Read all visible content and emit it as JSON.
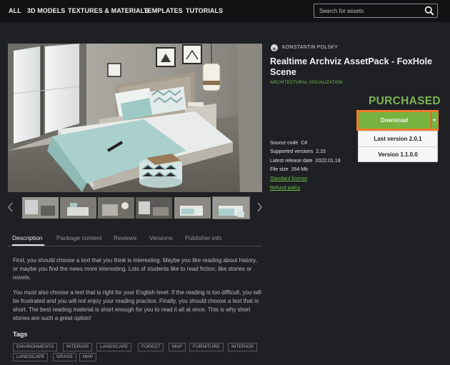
{
  "nav": {
    "items": [
      "ALL",
      "3D MODELS",
      "TEXTURES & MATERIALS",
      "TEMPLATES",
      "TUTORIALS"
    ],
    "search_placeholder": "Search for assets",
    "search_icon": "search-icon"
  },
  "product": {
    "author": "KONSTANTIN POLSKY",
    "title": "Realtime Archviz AssetPack - FoxHole Scene",
    "category": "ARCHITECTURAL VISUALIZATION",
    "status": "PURCHASED",
    "download_label": "Download",
    "versions": [
      "Last version 2.0.1",
      "Version 1.1.0.0"
    ],
    "meta": {
      "source_label": "Source code",
      "source_value": "C#",
      "supported_label": "Supported versions",
      "supported_value": "2.15",
      "release_label": "Latest release date",
      "release_value": "2022.01.18",
      "size_label": "File size",
      "size_value": "354 Mb"
    },
    "links": [
      "Standard license",
      "Refund policy"
    ]
  },
  "tabs": [
    "Description",
    "Package content",
    "Reviews",
    "Versions",
    "Publisher info"
  ],
  "description": [
    "First, you should choose a text that you think is interesting. Maybe you like reading about history, or maybe you find the news more interesting. Lots of students like to read fiction, like stories or novels.",
    "You must also choose a text that is right for your English level. If the reading is too difficult, you will be frustrated and you will not enjoy your reading practice. Finally, you should choose a text that is short. The best reading material is short enough for you to read it all at once. This is why short stories are such a great option!"
  ],
  "tags": {
    "title": "Tags",
    "items": [
      "ENVIRONMENTS",
      "INTERIOR",
      "LANDSCAPE",
      "FOREST",
      "MAP",
      "FURNITURE",
      "INTERIOR",
      "LANDSCAPE",
      "GRASS",
      "MAP"
    ]
  },
  "colors": {
    "accent_green": "#77b240",
    "highlight_orange": "#ef7b2a",
    "purchased_green": "#7fb356",
    "link_green": "#6ec04a"
  }
}
